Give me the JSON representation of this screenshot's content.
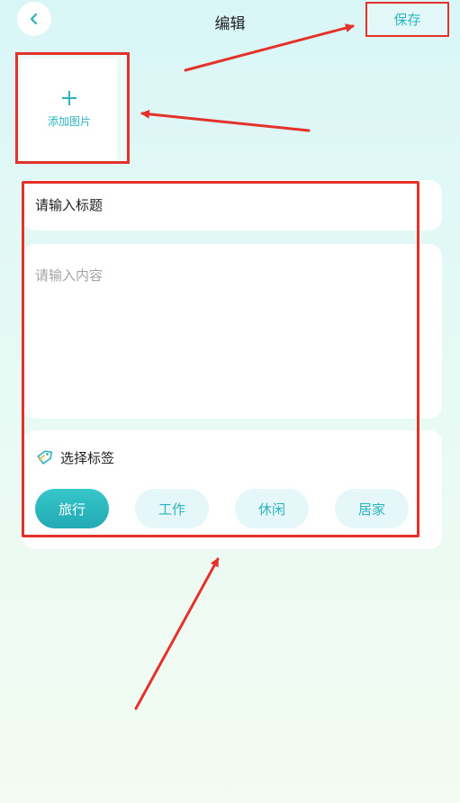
{
  "header": {
    "title": "编辑",
    "save_label": "保存"
  },
  "add_image": {
    "label": "添加图片"
  },
  "form": {
    "title_input": "请输入标题",
    "content_placeholder": "请输入内容"
  },
  "tags": {
    "heading": "选择标签",
    "items": [
      {
        "label": "旅行",
        "selected": true
      },
      {
        "label": "工作",
        "selected": false
      },
      {
        "label": "休闲",
        "selected": false
      },
      {
        "label": "居家",
        "selected": false
      }
    ]
  },
  "colors": {
    "accent": "#2bb3bd",
    "annotation_red": "#e4322b",
    "chip_bg": "#e5f7f8"
  },
  "icons": {
    "back": "chevron-left-icon",
    "add": "plus-icon",
    "tag": "tag-icon"
  }
}
